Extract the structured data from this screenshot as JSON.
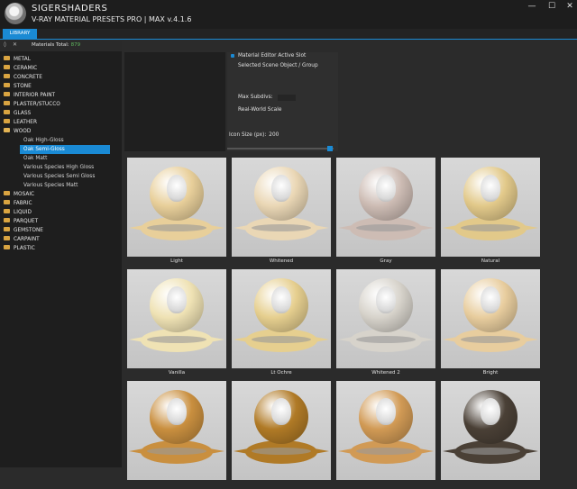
{
  "titlebar": {
    "brand": "SIGERSHADERS",
    "app_title": "V-RAY MATERIAL PRESETS PRO | MAX v.4.1.6",
    "minimize": "—",
    "maximize": "☐",
    "close": "✕"
  },
  "tabs": [
    {
      "label": "LIBRARY"
    }
  ],
  "sidebar": {
    "icons": {
      "refresh": "◊",
      "close": "✕"
    },
    "materials_total_label": "Materials Total:",
    "materials_total_count": "879",
    "categories": [
      {
        "label": "METAL"
      },
      {
        "label": "CERAMIC"
      },
      {
        "label": "CONCRETE"
      },
      {
        "label": "STONE"
      },
      {
        "label": "INTERIOR PAINT"
      },
      {
        "label": "PLASTER/STUCCO"
      },
      {
        "label": "GLASS"
      },
      {
        "label": "LEATHER"
      },
      {
        "label": "WOOD"
      }
    ],
    "wood_children": [
      {
        "label": "Oak High-Gloss"
      },
      {
        "label": "Oak Semi-Gloss"
      },
      {
        "label": "Oak Matt"
      },
      {
        "label": "Various Species High Gloss"
      },
      {
        "label": "Various Species Semi Gloss"
      },
      {
        "label": "Various Species Matt"
      }
    ],
    "categories_after": [
      {
        "label": "MOSAIC"
      },
      {
        "label": "FABRIC"
      },
      {
        "label": "LIQUID"
      },
      {
        "label": "PARQUET"
      },
      {
        "label": "GEMSTONE"
      },
      {
        "label": "CARPAINT"
      },
      {
        "label": "PLASTIC"
      }
    ]
  },
  "options": {
    "active_slot": "Material Editor Active Slot",
    "selected_scene": "Selected Scene Object / Group",
    "max_subdivs": "Max Subdivs:",
    "real_world_scale": "Real-World Scale",
    "icon_size_label": "Icon Size (px):",
    "icon_size_value": "200"
  },
  "thumbnails": [
    {
      "caption": "Light",
      "color": "#e8cf9a"
    },
    {
      "caption": "Whitened",
      "color": "#ead7b5"
    },
    {
      "caption": "Gray",
      "color": "#cdbcb4"
    },
    {
      "caption": "Natural",
      "color": "#e2c98a"
    },
    {
      "caption": "Vanilla",
      "color": "#efe2b4"
    },
    {
      "caption": "Lt Ochre",
      "color": "#e6cf8f"
    },
    {
      "caption": "Whitened 2",
      "color": "#d7d3cb"
    },
    {
      "caption": "Bright",
      "color": "#e8cd9e"
    },
    {
      "caption": "",
      "color": "#c98f3f"
    },
    {
      "caption": "",
      "color": "#b07a26"
    },
    {
      "caption": "",
      "color": "#d19a55"
    },
    {
      "caption": "",
      "color": "#4a4036"
    }
  ]
}
